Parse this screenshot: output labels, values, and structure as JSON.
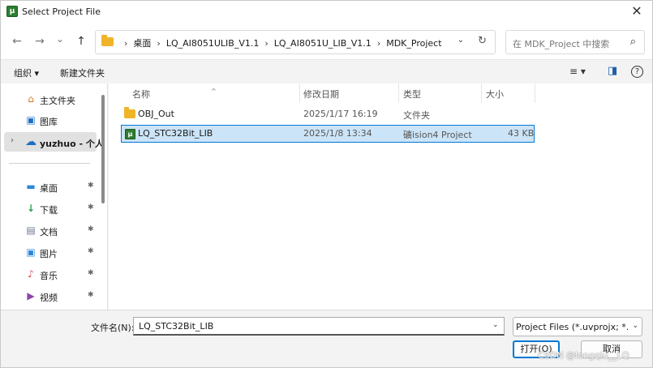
{
  "window": {
    "title": "Select Project File",
    "close_glyph": "✕"
  },
  "nav": {
    "back_glyph": "←",
    "forward_glyph": "→",
    "recent_glyph": "⌄",
    "up_glyph": "↑",
    "breadcrumb": [
      "桌面",
      "LQ_AI8051ULIB_V1.1",
      "LQ_AI8051U_LIB_V1.1",
      "MDK_Project"
    ],
    "sep_glyph": "›",
    "dropdown_glyph": "⌄",
    "refresh_glyph": "↻",
    "search_placeholder": "在 MDK_Project 中搜索",
    "search_glyph": "⌕"
  },
  "toolbar": {
    "organize": "组织 ▾",
    "new_folder": "新建文件夹",
    "view_glyph": "≡ ▾",
    "pane_glyph": "◨",
    "help_glyph": "?"
  },
  "sidebar": {
    "items": [
      {
        "label": "主文件夹",
        "icon": "home-icon",
        "glyph": "⌂",
        "color": "#d07a27"
      },
      {
        "label": "图库",
        "icon": "gallery-icon",
        "glyph": "▣",
        "color": "#1e6fc2"
      },
      {
        "label": "yuzhuo - 个人",
        "icon": "cloud-icon",
        "glyph": "☁",
        "color": "#1e6fc2",
        "chevron": "›"
      }
    ],
    "pinned": [
      {
        "label": "桌面",
        "icon": "desktop-icon",
        "glyph": "▬",
        "color": "#2b88d8"
      },
      {
        "label": "下载",
        "icon": "download-icon",
        "glyph": "↓",
        "color": "#2e9e55"
      },
      {
        "label": "文档",
        "icon": "document-icon",
        "glyph": "▤",
        "color": "#6b7a8c"
      },
      {
        "label": "图片",
        "icon": "pictures-icon",
        "glyph": "▣",
        "color": "#2b88d8"
      },
      {
        "label": "音乐",
        "icon": "music-icon",
        "glyph": "♪",
        "color": "#d9534f"
      },
      {
        "label": "视频",
        "icon": "video-icon",
        "glyph": "▶",
        "color": "#8e44ad"
      }
    ],
    "pin_glyph": "📌"
  },
  "filelist": {
    "columns": {
      "name": "名称",
      "modified": "修改日期",
      "type": "类型",
      "size": "大小"
    },
    "sort_glyph": "^",
    "rows": [
      {
        "name": "OBJ_Out",
        "modified": "2025/1/17 16:19",
        "type": "文件夹",
        "size": "",
        "kind": "folder"
      },
      {
        "name": "LQ_STC32Bit_LIB",
        "modified": "2025/1/8 13:34",
        "type": "礦ision4 Project",
        "size": "43 KB",
        "kind": "project"
      }
    ]
  },
  "bottom": {
    "filename_label": "文件名(N):",
    "filename_value": "LQ_STC32Bit_LIB",
    "filetype_value": "Project Files (*.uvprojx; *.uvp",
    "open_label": "打开(O)",
    "cancel_label": "取消",
    "dropdown_glyph": "⌄"
  },
  "watermark": "CSDN @longqiu__LQ"
}
